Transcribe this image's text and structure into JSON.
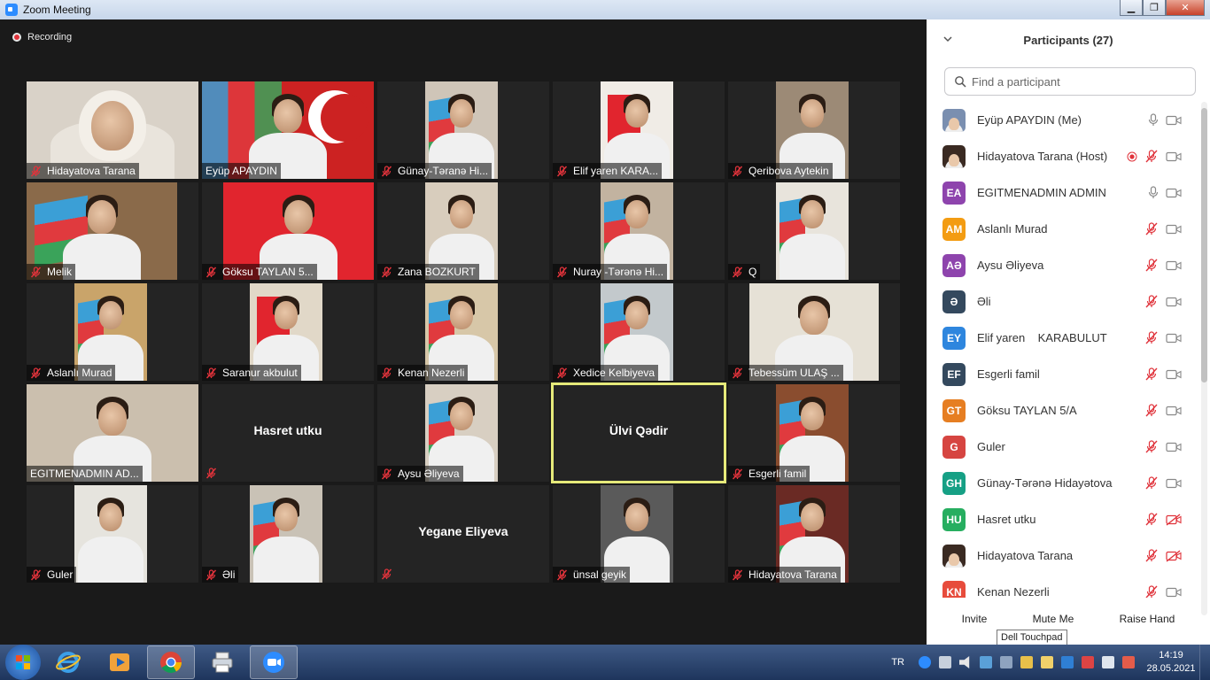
{
  "window": {
    "title": "Zoom Meeting"
  },
  "meeting": {
    "recording_label": "Recording"
  },
  "tiles": [
    {
      "name": "Hidayatova Tarana",
      "muted": true
    },
    {
      "name": "Eyüp APAYDIN",
      "muted": false
    },
    {
      "name": "Günay-Təranə Hi...",
      "muted": true
    },
    {
      "name": "Elif yaren   KARA...",
      "muted": true
    },
    {
      "name": "Qeribova Aytekin",
      "muted": true
    },
    {
      "name": "Melik",
      "muted": true
    },
    {
      "name": "Göksu TAYLAN 5...",
      "muted": true
    },
    {
      "name": "Zana BOZKURT",
      "muted": true
    },
    {
      "name": "Nuray -Tərənə Hi...",
      "muted": true
    },
    {
      "name": "Q",
      "muted": true
    },
    {
      "name": "Aslanlı Murad",
      "muted": true
    },
    {
      "name": "Saranur akbulut",
      "muted": true
    },
    {
      "name": "Kenan Nezerli",
      "muted": true
    },
    {
      "name": "Xedice Kelbiyeva",
      "muted": true
    },
    {
      "name": "Tebessüm ULAŞ ...",
      "muted": true
    },
    {
      "name": "EGITMENADMIN AD...",
      "muted": false
    },
    {
      "name": "Hasret utku",
      "muted": true,
      "no_video": true
    },
    {
      "name": "Aysu Əliyeva",
      "muted": true
    },
    {
      "name": "Ülvi Qədir",
      "muted": false,
      "no_video": true,
      "active_speaker": true
    },
    {
      "name": "Esgerli famil",
      "muted": true
    },
    {
      "name": "Guler",
      "muted": true
    },
    {
      "name": "Əli",
      "muted": true
    },
    {
      "name": "Yegane Eliyeva",
      "muted": true,
      "no_video": true
    },
    {
      "name": "ünsal geyik",
      "muted": true
    },
    {
      "name": "Hidayatova Tarana",
      "muted": true
    }
  ],
  "participants": {
    "title": "Participants (27)",
    "search_placeholder": "Find a participant",
    "list": [
      {
        "name": "Eyüp APAYDIN (Me)",
        "initials": "",
        "color": "#7a8fb0",
        "mic": "on",
        "video": "on",
        "photo": true
      },
      {
        "name": "Hidayatova Tarana (Host)",
        "initials": "",
        "color": "#3a2a22",
        "mic": "muted",
        "video": "on",
        "photo": true,
        "recording": true
      },
      {
        "name": "EGITMENADMIN ADMIN",
        "initials": "EA",
        "color": "#8e44ad",
        "mic": "on",
        "video": "on"
      },
      {
        "name": "Aslanlı Murad",
        "initials": "AM",
        "color": "#f39c12",
        "mic": "muted",
        "video": "on"
      },
      {
        "name": "Aysu Əliyeva",
        "initials": "AƏ",
        "color": "#8e44ad",
        "mic": "muted",
        "video": "on"
      },
      {
        "name": "Əli",
        "initials": "Ə",
        "color": "#34495e",
        "mic": "muted",
        "video": "on"
      },
      {
        "name": "Elif yaren    KARABULUT",
        "initials": "EY",
        "color": "#2e86de",
        "mic": "muted",
        "video": "on"
      },
      {
        "name": "Esgerli famil",
        "initials": "EF",
        "color": "#34495e",
        "mic": "muted",
        "video": "on"
      },
      {
        "name": "Göksu TAYLAN 5/A",
        "initials": "GT",
        "color": "#e67e22",
        "mic": "muted",
        "video": "on"
      },
      {
        "name": "Guler",
        "initials": "G",
        "color": "#d64541",
        "mic": "muted",
        "video": "on"
      },
      {
        "name": "Günay-Tərənə Hidayətova",
        "initials": "GH",
        "color": "#16a085",
        "mic": "muted",
        "video": "on"
      },
      {
        "name": "Hasret utku",
        "initials": "HU",
        "color": "#27ae60",
        "mic": "muted",
        "video": "off"
      },
      {
        "name": "Hidayatova Tarana",
        "initials": "",
        "color": "#3a2a22",
        "mic": "muted",
        "video": "off",
        "photo": true
      },
      {
        "name": "Kenan Nezerli",
        "initials": "KN",
        "color": "#e74c3c",
        "mic": "muted",
        "video": "on"
      }
    ],
    "footer": {
      "invite": "Invite",
      "mute_me": "Mute Me",
      "raise_hand": "Raise Hand"
    }
  },
  "tooltip": "Dell Touchpad",
  "taskbar": {
    "lang": "TR",
    "time": "14:19",
    "date": "28.05.2021"
  }
}
